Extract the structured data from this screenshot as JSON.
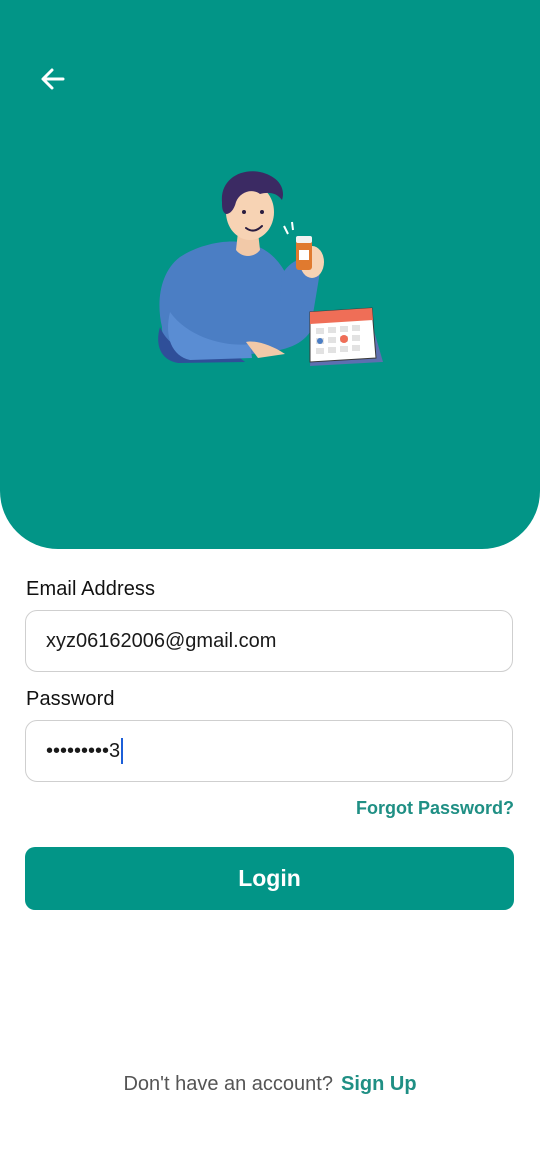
{
  "header": {
    "back_icon": "arrow-left-icon",
    "illustration": "man-holding-pill-bottle-with-calendar"
  },
  "form": {
    "email_label": "Email Address",
    "email_value": "xyz06162006@gmail.com",
    "password_label": "Password",
    "password_value": "•••••••••3",
    "forgot_password": "Forgot Password?"
  },
  "actions": {
    "login_label": "Login"
  },
  "footer": {
    "signup_prompt": "Don't have an account?",
    "signup_link": "Sign Up"
  },
  "colors": {
    "primary": "#029587",
    "link": "#1f8f84",
    "background": "#ffffff"
  }
}
